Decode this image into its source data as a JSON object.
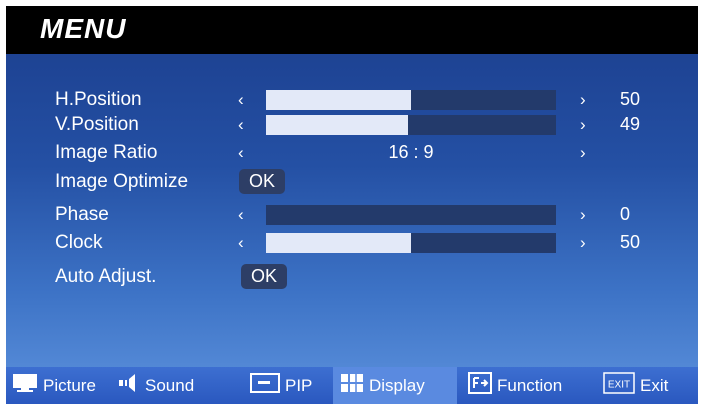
{
  "title": "MENU",
  "rows": [
    {
      "label": "H.Position",
      "value": "50",
      "level": 0.5
    },
    {
      "label": "V.Position",
      "value": "49",
      "level": 0.49
    },
    {
      "label": "Image Ratio",
      "ratio": "16 : 9"
    },
    {
      "label": "Image Optimize",
      "button": "OK"
    },
    {
      "label": "Phase",
      "value": "0",
      "level": 0.0
    },
    {
      "label": "Clock",
      "value": "50",
      "level": 0.5
    },
    {
      "label": "Auto Adjust.",
      "button": "OK"
    }
  ],
  "tabs": [
    {
      "label": "Picture",
      "icon": "monitor-icon"
    },
    {
      "label": "Sound",
      "icon": "speaker-icon"
    },
    {
      "label": "PIP",
      "icon": "pip-icon"
    },
    {
      "label": "Display",
      "icon": "display-grid-icon",
      "active": true
    },
    {
      "label": "Function",
      "icon": "function-icon"
    },
    {
      "label": "Exit",
      "icon": "exit-icon",
      "badge": "EXIT"
    }
  ],
  "colors": {
    "accent": "#5a8ae0",
    "bar_fill": "#e3e9f8",
    "bar_track": "#233a6b"
  }
}
